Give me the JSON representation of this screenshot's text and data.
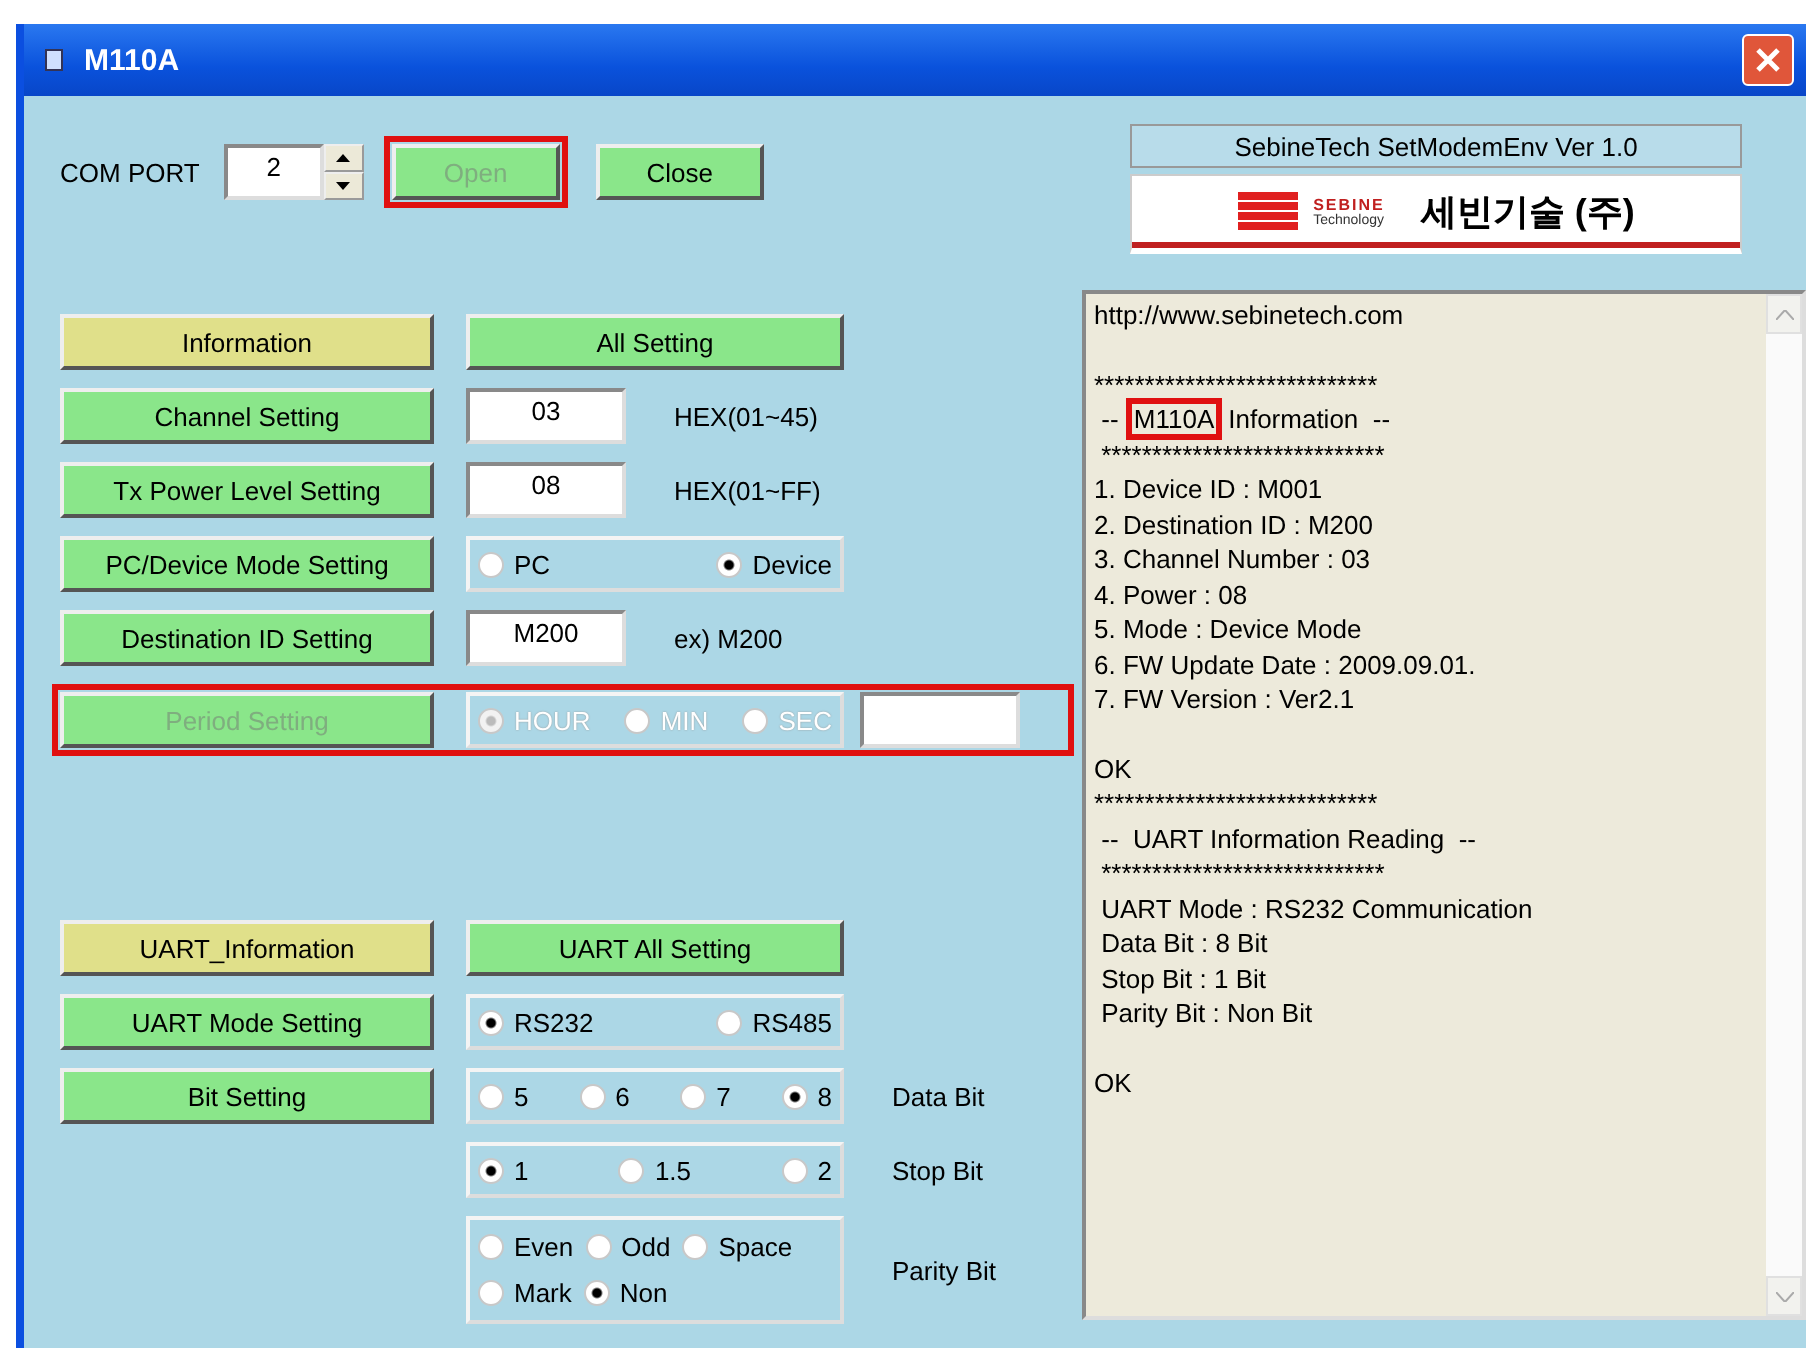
{
  "window": {
    "title": "M110A"
  },
  "com_port": {
    "label": "COM PORT",
    "value": "2"
  },
  "connection_buttons": [
    {
      "label": "Open",
      "disabled": true,
      "highlighted": true
    },
    {
      "label": "Close",
      "disabled": false,
      "highlighted": false
    }
  ],
  "about": {
    "version": "SebineTech SetModemEnv  Ver 1.0",
    "logo_brand": "SEBINE",
    "logo_sub": "Technology",
    "logo_name": "세빈기술 (주)"
  },
  "settings": [
    {
      "kind": "action",
      "button": {
        "label": "Information",
        "kind": "info"
      },
      "action": {
        "label": "All Setting"
      },
      "disabled": false,
      "highlighted": false
    },
    {
      "kind": "field",
      "button": {
        "label": "Channel Setting",
        "kind": "setting"
      },
      "value": "03",
      "hint": "HEX(01~45)",
      "disabled": false,
      "highlighted": false
    },
    {
      "kind": "field",
      "button": {
        "label": "Tx Power Level Setting",
        "kind": "setting"
      },
      "value": "08",
      "hint": "HEX(01~FF)",
      "disabled": false,
      "highlighted": false
    },
    {
      "kind": "radio",
      "button": {
        "label": "PC/Device Mode Setting",
        "kind": "setting"
      },
      "options": [
        {
          "label": "PC",
          "selected": false
        },
        {
          "label": "Device",
          "selected": true
        }
      ],
      "disabled": false,
      "highlighted": false
    },
    {
      "kind": "field",
      "button": {
        "label": "Destination ID Setting",
        "kind": "setting"
      },
      "value": "M200",
      "hint": "ex) M200",
      "disabled": false,
      "highlighted": false
    },
    {
      "kind": "period",
      "button": {
        "label": "Period Setting",
        "kind": "setting"
      },
      "options": [
        {
          "label": "HOUR",
          "selected": true
        },
        {
          "label": "MIN",
          "selected": false
        },
        {
          "label": "SEC",
          "selected": false
        }
      ],
      "disabled": true,
      "highlighted": true
    }
  ],
  "uart": [
    {
      "kind": "action",
      "button": {
        "label": "UART_Information",
        "kind": "info"
      },
      "action": {
        "label": "UART All Setting"
      }
    },
    {
      "kind": "radio",
      "button": {
        "label": "UART Mode Setting",
        "kind": "setting"
      },
      "options": [
        {
          "label": "RS232",
          "selected": true
        },
        {
          "label": "RS485",
          "selected": false
        }
      ]
    },
    {
      "kind": "radio",
      "button": {
        "label": "Bit Setting",
        "kind": "setting"
      },
      "options": [
        {
          "label": "5",
          "selected": false
        },
        {
          "label": "6",
          "selected": false
        },
        {
          "label": "7",
          "selected": false
        },
        {
          "label": "8",
          "selected": true
        }
      ],
      "hint": "Data Bit"
    },
    {
      "kind": "radio",
      "options": [
        {
          "label": "1",
          "selected": true
        },
        {
          "label": "1.5",
          "selected": false
        },
        {
          "label": "2",
          "selected": false
        }
      ],
      "hint": "Stop Bit"
    },
    {
      "kind": "radio",
      "options": [
        {
          "label": "Even",
          "selected": false
        },
        {
          "label": "Odd",
          "selected": false
        },
        {
          "label": "Space",
          "selected": false
        },
        {
          "label": "Mark",
          "selected": false
        },
        {
          "label": "Non",
          "selected": true
        }
      ],
      "hint": "Parity Bit"
    }
  ],
  "log_blocks": [
    [
      {
        "text": "http://www.sebinetech.com"
      }
    ],
    [
      {
        "text": "****************************"
      },
      {
        "text": " -- ",
        "mark": "M110A",
        "rest": "Information  --"
      },
      {
        "text": " ****************************"
      },
      {
        "text": "1. Device ID : M001"
      },
      {
        "text": "2. Destination ID : M200"
      },
      {
        "text": "3. Channel Number : 03"
      },
      {
        "text": "4. Power : 08"
      },
      {
        "text": "5. Mode : Device Mode"
      },
      {
        "text": "6. FW Update Date : 2009.09.01."
      },
      {
        "text": "7. FW Version : Ver2.1"
      }
    ],
    [
      {
        "text": "OK"
      },
      {
        "text": "****************************"
      },
      {
        "text": " --  UART Information Reading  --"
      },
      {
        "text": " ****************************"
      },
      {
        "text": " UART Mode : RS232 Communication"
      },
      {
        "text": " Data Bit : 8 Bit"
      },
      {
        "text": " Stop Bit : 1 Bit"
      },
      {
        "text": " Parity Bit : Non Bit"
      }
    ],
    [
      {
        "text": "OK"
      }
    ]
  ]
}
